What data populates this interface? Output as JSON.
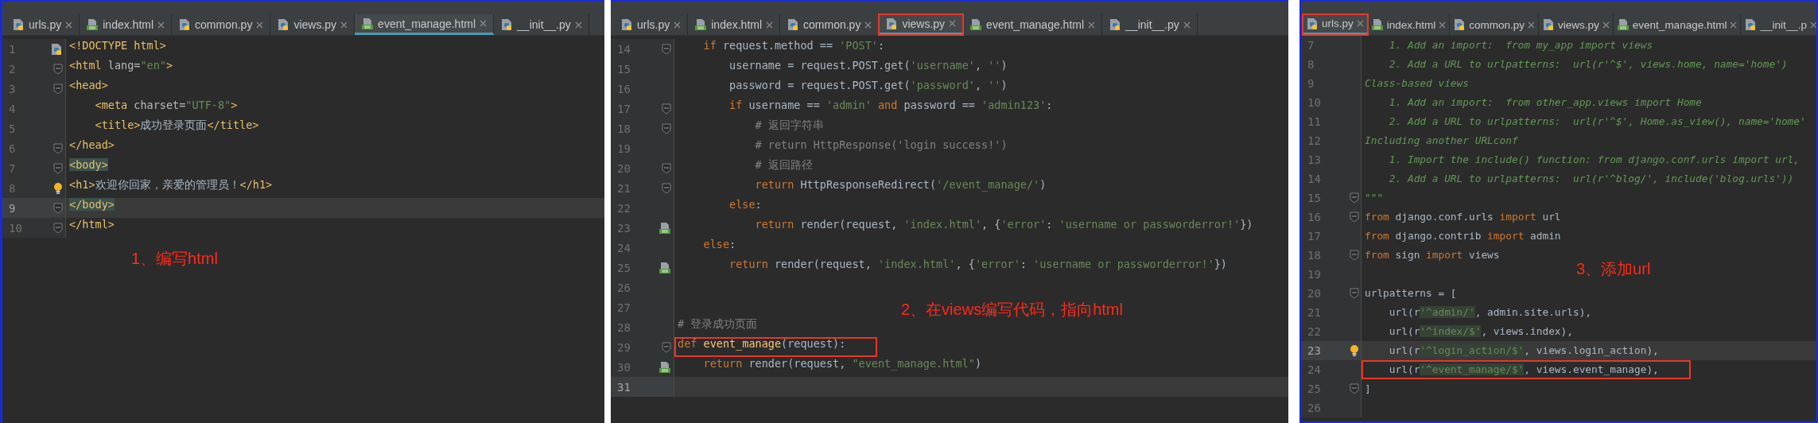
{
  "panels": [
    {
      "tabs": [
        {
          "label": "urls.py",
          "kind": "python",
          "selected": false,
          "boxed": false
        },
        {
          "label": "index.html",
          "kind": "html",
          "selected": false,
          "boxed": false
        },
        {
          "label": "common.py",
          "kind": "python",
          "selected": false,
          "boxed": false
        },
        {
          "label": "views.py",
          "kind": "python",
          "selected": false,
          "boxed": false
        },
        {
          "label": "event_manage.html",
          "kind": "html",
          "selected": true,
          "boxed": false
        },
        {
          "label": "__init__.py",
          "kind": "python",
          "selected": false,
          "boxed": false
        }
      ],
      "lines": [
        {
          "number": "1",
          "kind": "python",
          "current": false,
          "boxed": false,
          "tokens": [
            {
              "text": "<!DOCTYPE html>",
              "kind": "tag"
            }
          ]
        },
        {
          "number": "2",
          "kind": "fold",
          "current": false,
          "boxed": false,
          "tokens": [
            {
              "text": "<html ",
              "kind": "tag"
            },
            {
              "text": "lang=",
              "kind": "attr"
            },
            {
              "text": "\"en\"",
              "kind": "str"
            },
            {
              "text": ">",
              "kind": "tag"
            }
          ]
        },
        {
          "number": "3",
          "kind": "fold",
          "current": false,
          "boxed": false,
          "tokens": [
            {
              "text": "<head>",
              "kind": "tag"
            }
          ]
        },
        {
          "number": "4",
          "kind": "plain",
          "current": false,
          "boxed": false,
          "tokens": [
            {
              "text": "    <meta ",
              "kind": "tag"
            },
            {
              "text": "charset=",
              "kind": "attr"
            },
            {
              "text": "\"UTF-8\"",
              "kind": "str"
            },
            {
              "text": ">",
              "kind": "tag"
            }
          ]
        },
        {
          "number": "5",
          "kind": "plain",
          "current": false,
          "boxed": false,
          "tokens": [
            {
              "text": "    <title>",
              "kind": "tag"
            },
            {
              "text": "成功登录页面",
              "kind": "plain"
            },
            {
              "text": "</title>",
              "kind": "tag"
            }
          ]
        },
        {
          "number": "6",
          "kind": "fold",
          "current": false,
          "boxed": false,
          "tokens": [
            {
              "text": "</head>",
              "kind": "tag"
            }
          ]
        },
        {
          "number": "7",
          "kind": "fold",
          "current": false,
          "boxed": false,
          "tokens": [
            {
              "text": "<body>",
              "kind": "match"
            }
          ]
        },
        {
          "number": "8",
          "kind": "bulb",
          "current": false,
          "boxed": false,
          "tokens": [
            {
              "text": "<h1>",
              "kind": "tag"
            },
            {
              "text": "欢迎你回家，亲爱的管理员！",
              "kind": "plain"
            },
            {
              "text": "</h1>",
              "kind": "tag"
            }
          ]
        },
        {
          "number": "9",
          "kind": "fold",
          "current": true,
          "boxed": false,
          "tokens": [
            {
              "text": "</body>",
              "kind": "match"
            }
          ]
        },
        {
          "number": "10",
          "kind": "fold",
          "current": false,
          "boxed": false,
          "tokens": [
            {
              "text": "</html>",
              "kind": "tag"
            }
          ]
        }
      ],
      "annotation": "1、编写html"
    },
    {
      "tabs": [
        {
          "label": "urls.py",
          "kind": "python",
          "selected": false,
          "boxed": false
        },
        {
          "label": "index.html",
          "kind": "html",
          "selected": false,
          "boxed": false
        },
        {
          "label": "common.py",
          "kind": "python",
          "selected": false,
          "boxed": false
        },
        {
          "label": "views.py",
          "kind": "python",
          "selected": true,
          "boxed": true
        },
        {
          "label": "event_manage.html",
          "kind": "html",
          "selected": false,
          "boxed": false
        },
        {
          "label": "__init__.py",
          "kind": "python",
          "selected": false,
          "boxed": false
        }
      ],
      "lines": [
        {
          "number": "14",
          "kind": "fold",
          "current": false,
          "boxed": false,
          "tokens": [
            {
              "text": "    if",
              "kind": "kw"
            },
            {
              "text": " request.method == ",
              "kind": "plain"
            },
            {
              "text": "'POST'",
              "kind": "str"
            },
            {
              "text": ":",
              "kind": "plain"
            }
          ]
        },
        {
          "number": "15",
          "kind": "plain",
          "current": false,
          "boxed": false,
          "tokens": [
            {
              "text": "        username = request.POST.get(",
              "kind": "plain"
            },
            {
              "text": "'username'",
              "kind": "str"
            },
            {
              "text": ", ",
              "kind": "plain"
            },
            {
              "text": "''",
              "kind": "str"
            },
            {
              "text": ")",
              "kind": "plain"
            }
          ]
        },
        {
          "number": "16",
          "kind": "plain",
          "current": false,
          "boxed": false,
          "tokens": [
            {
              "text": "        password = request.POST.get(",
              "kind": "plain"
            },
            {
              "text": "'password'",
              "kind": "str"
            },
            {
              "text": ", ",
              "kind": "plain"
            },
            {
              "text": "''",
              "kind": "str"
            },
            {
              "text": ")",
              "kind": "plain"
            }
          ]
        },
        {
          "number": "17",
          "kind": "fold",
          "current": false,
          "boxed": false,
          "tokens": [
            {
              "text": "        if",
              "kind": "kw"
            },
            {
              "text": " username == ",
              "kind": "plain"
            },
            {
              "text": "'admin'",
              "kind": "str"
            },
            {
              "text": " and",
              "kind": "kw"
            },
            {
              "text": " password == ",
              "kind": "plain"
            },
            {
              "text": "'admin123'",
              "kind": "str"
            },
            {
              "text": ":",
              "kind": "plain"
            }
          ]
        },
        {
          "number": "18",
          "kind": "fold",
          "current": false,
          "boxed": false,
          "tokens": [
            {
              "text": "            # 返回字符串",
              "kind": "comment"
            }
          ]
        },
        {
          "number": "19",
          "kind": "plain",
          "current": false,
          "boxed": false,
          "tokens": [
            {
              "text": "            # return HttpResponse('login success!')",
              "kind": "comment"
            }
          ]
        },
        {
          "number": "20",
          "kind": "fold",
          "current": false,
          "boxed": false,
          "tokens": [
            {
              "text": "            # 返回路径",
              "kind": "comment"
            }
          ]
        },
        {
          "number": "21",
          "kind": "fold",
          "current": false,
          "boxed": false,
          "tokens": [
            {
              "text": "            return",
              "kind": "kw"
            },
            {
              "text": " HttpResponseRedirect(",
              "kind": "plain"
            },
            {
              "text": "'/event_manage/'",
              "kind": "str"
            },
            {
              "text": ")",
              "kind": "plain"
            }
          ]
        },
        {
          "number": "22",
          "kind": "plain",
          "current": false,
          "boxed": false,
          "tokens": [
            {
              "text": "        else",
              "kind": "kw"
            },
            {
              "text": ":",
              "kind": "plain"
            }
          ]
        },
        {
          "number": "23",
          "kind": "html",
          "current": false,
          "boxed": false,
          "tokens": [
            {
              "text": "            return",
              "kind": "kw"
            },
            {
              "text": " render(request, ",
              "kind": "plain"
            },
            {
              "text": "'index.html'",
              "kind": "str"
            },
            {
              "text": ", {",
              "kind": "plain"
            },
            {
              "text": "'error'",
              "kind": "str"
            },
            {
              "text": ": ",
              "kind": "plain"
            },
            {
              "text": "'username or passworderror!'",
              "kind": "str"
            },
            {
              "text": "})",
              "kind": "plain"
            }
          ]
        },
        {
          "number": "24",
          "kind": "plain",
          "current": false,
          "boxed": false,
          "tokens": [
            {
              "text": "    else",
              "kind": "kw"
            },
            {
              "text": ":",
              "kind": "plain"
            }
          ]
        },
        {
          "number": "25",
          "kind": "html",
          "current": false,
          "boxed": false,
          "tokens": [
            {
              "text": "        return",
              "kind": "kw"
            },
            {
              "text": " render(request, ",
              "kind": "plain"
            },
            {
              "text": "'index.html'",
              "kind": "str"
            },
            {
              "text": ", {",
              "kind": "plain"
            },
            {
              "text": "'error'",
              "kind": "str"
            },
            {
              "text": ": ",
              "kind": "plain"
            },
            {
              "text": "'username or passworderror!'",
              "kind": "str"
            },
            {
              "text": "})",
              "kind": "plain"
            }
          ]
        },
        {
          "number": "26",
          "kind": "plain"
        },
        {
          "number": "27",
          "kind": "plain"
        },
        {
          "number": "28",
          "kind": "plain",
          "current": false,
          "boxed": false,
          "tokens": [
            {
              "text": "# 登录成功页面",
              "kind": "comment"
            }
          ]
        },
        {
          "number": "29",
          "kind": "fold",
          "current": false,
          "boxed": true,
          "tokens": [
            {
              "text": "def",
              "kind": "kw"
            },
            {
              "text": " event_manage",
              "kind": "func"
            },
            {
              "text": "(request):",
              "kind": "plain"
            }
          ]
        },
        {
          "number": "30",
          "kind": "html",
          "current": false,
          "boxed": false,
          "tokens": [
            {
              "text": "    return",
              "kind": "kw"
            },
            {
              "text": " render(request, ",
              "kind": "plain"
            },
            {
              "text": "\"event_manage.html\"",
              "kind": "str"
            },
            {
              "text": ")",
              "kind": "plain"
            }
          ]
        },
        {
          "number": "31",
          "kind": "plain",
          "current": true
        }
      ],
      "annotation": "2、在views编写代码，指向html"
    },
    {
      "tabs": [
        {
          "label": "urls.py",
          "kind": "python",
          "selected": true,
          "boxed": true
        },
        {
          "label": "index.html",
          "kind": "html",
          "selected": false,
          "boxed": false
        },
        {
          "label": "common.py",
          "kind": "python",
          "selected": false,
          "boxed": false
        },
        {
          "label": "views.py",
          "kind": "python",
          "selected": false,
          "boxed": false
        },
        {
          "label": "event_manage.html",
          "kind": "html",
          "selected": false,
          "boxed": false
        },
        {
          "label": "__init__.p",
          "kind": "python",
          "selected": false,
          "boxed": false
        }
      ],
      "lines": [
        {
          "number": "7",
          "kind": "plain",
          "current": false,
          "boxed": false,
          "tokens": [
            {
              "text": "    1. Add an import:  from my_app import views",
              "kind": "doc"
            }
          ]
        },
        {
          "number": "8",
          "kind": "plain",
          "current": false,
          "boxed": false,
          "tokens": [
            {
              "text": "    2. Add a URL to urlpatterns:  url(r'^$', views.home, name='home')",
              "kind": "doc"
            }
          ]
        },
        {
          "number": "9",
          "kind": "plain",
          "current": false,
          "boxed": false,
          "tokens": [
            {
              "text": "Class-based views",
              "kind": "doc"
            }
          ]
        },
        {
          "number": "10",
          "kind": "plain",
          "current": false,
          "boxed": false,
          "tokens": [
            {
              "text": "    1. Add an import:  from other_app.views import Home",
              "kind": "doc"
            }
          ]
        },
        {
          "number": "11",
          "kind": "plain",
          "current": false,
          "boxed": false,
          "tokens": [
            {
              "text": "    2. Add a URL to urlpatterns:  url(r'^$', Home.as_view(), name='home'",
              "kind": "doc"
            }
          ]
        },
        {
          "number": "12",
          "kind": "plain",
          "current": false,
          "boxed": false,
          "tokens": [
            {
              "text": "Including another URLconf",
              "kind": "doc"
            }
          ]
        },
        {
          "number": "13",
          "kind": "plain",
          "current": false,
          "boxed": false,
          "tokens": [
            {
              "text": "    1. Import the include() function: from django.conf.urls import url,",
              "kind": "doc"
            }
          ]
        },
        {
          "number": "14",
          "kind": "plain",
          "current": false,
          "boxed": false,
          "tokens": [
            {
              "text": "    2. Add a URL to urlpatterns:  url(r'^blog/', include('blog.urls'))",
              "kind": "doc"
            }
          ]
        },
        {
          "number": "15",
          "kind": "fold",
          "current": false,
          "boxed": false,
          "tokens": [
            {
              "text": "\"\"\"",
              "kind": "doc"
            }
          ]
        },
        {
          "number": "16",
          "kind": "fold",
          "current": false,
          "boxed": false,
          "tokens": [
            {
              "text": "from",
              "kind": "kw"
            },
            {
              "text": " django.conf.urls ",
              "kind": "plain"
            },
            {
              "text": "import",
              "kind": "kw"
            },
            {
              "text": " url",
              "kind": "plain"
            }
          ]
        },
        {
          "number": "17",
          "kind": "plain",
          "current": false,
          "boxed": false,
          "tokens": [
            {
              "text": "from",
              "kind": "kw"
            },
            {
              "text": " django.contrib ",
              "kind": "plain"
            },
            {
              "text": "import",
              "kind": "kw"
            },
            {
              "text": " admin",
              "kind": "plain"
            }
          ]
        },
        {
          "number": "18",
          "kind": "fold",
          "current": false,
          "boxed": false,
          "tokens": [
            {
              "text": "from",
              "kind": "kw"
            },
            {
              "text": " sign ",
              "kind": "plain"
            },
            {
              "text": "import",
              "kind": "kw"
            },
            {
              "text": " views",
              "kind": "plain"
            }
          ]
        },
        {
          "number": "19",
          "kind": "plain"
        },
        {
          "number": "20",
          "kind": "fold",
          "current": false,
          "boxed": false,
          "tokens": [
            {
              "text": "urlpatterns = [",
              "kind": "plain"
            }
          ]
        },
        {
          "number": "21",
          "kind": "plain",
          "current": false,
          "boxed": false,
          "tokens": [
            {
              "text": "    url(r",
              "kind": "plain"
            },
            {
              "text": "'^admin/'",
              "kind": "strhl"
            },
            {
              "text": ", admin.site.urls),",
              "kind": "plain"
            }
          ]
        },
        {
          "number": "22",
          "kind": "plain",
          "current": false,
          "boxed": false,
          "tokens": [
            {
              "text": "    url(r",
              "kind": "plain"
            },
            {
              "text": "'^index/$'",
              "kind": "strhl"
            },
            {
              "text": ", views.index),",
              "kind": "plain"
            }
          ]
        },
        {
          "number": "23",
          "kind": "bulb",
          "current": true,
          "boxed": false,
          "tokens": [
            {
              "text": "    url(r",
              "kind": "plain"
            },
            {
              "text": "'^login_action/$'",
              "kind": "strhl"
            },
            {
              "text": ", views.login_action),",
              "kind": "plain"
            }
          ]
        },
        {
          "number": "24",
          "kind": "plain",
          "current": false,
          "boxed": true,
          "tokens": [
            {
              "text": "    url(r",
              "kind": "plain"
            },
            {
              "text": "'^event_manage/$'",
              "kind": "strhl"
            },
            {
              "text": ", views.event_manage),",
              "kind": "plain"
            }
          ]
        },
        {
          "number": "25",
          "kind": "fold",
          "current": false,
          "boxed": false,
          "tokens": [
            {
              "text": "]",
              "kind": "plain"
            }
          ]
        },
        {
          "number": "26",
          "kind": "plain"
        }
      ],
      "annotation": "3、添加url"
    }
  ]
}
